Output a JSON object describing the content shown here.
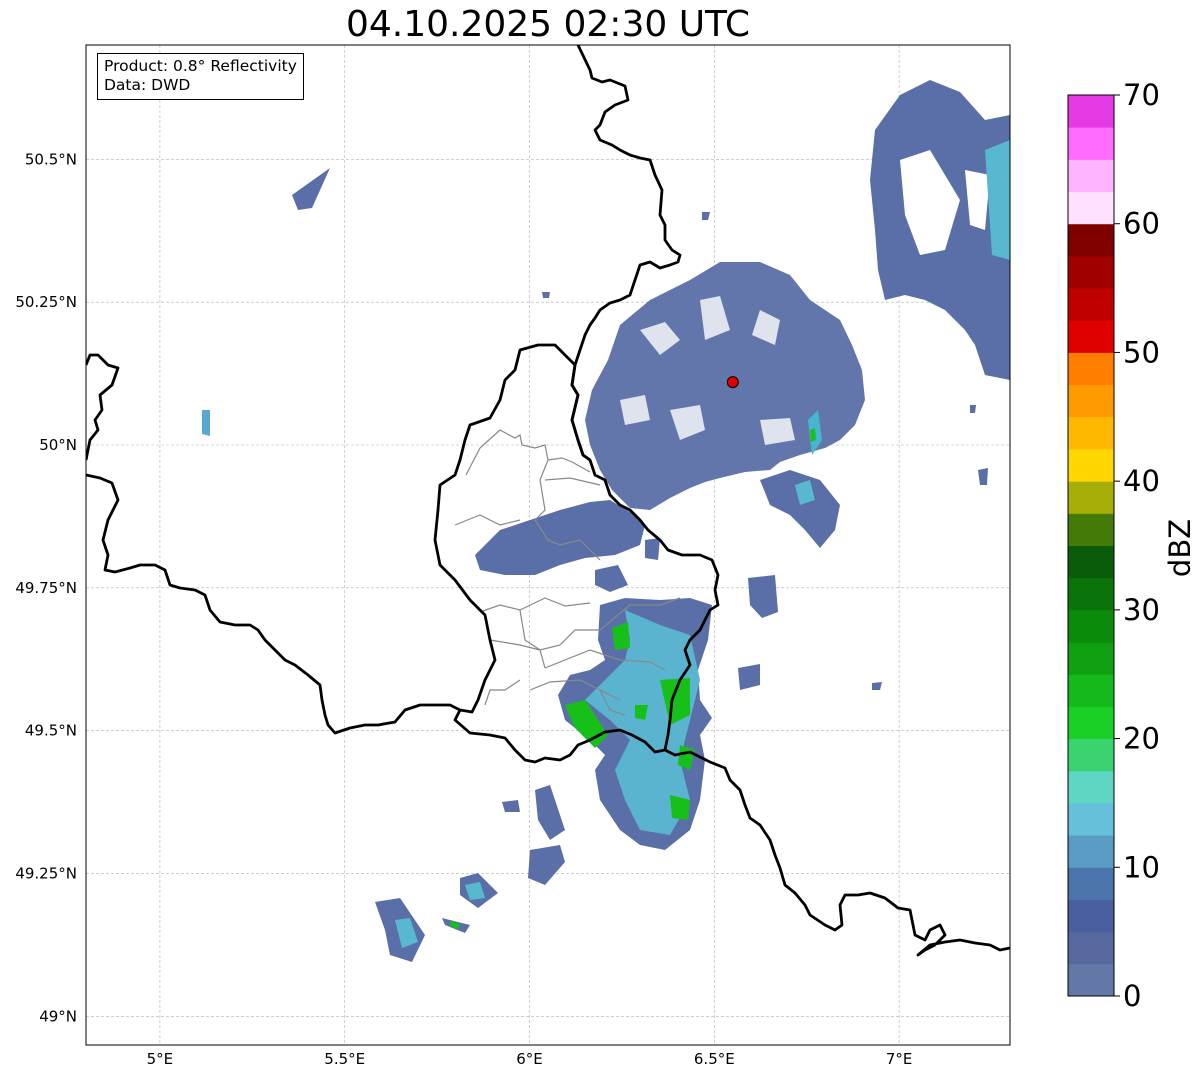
{
  "title": "04.10.2025 02:30 UTC",
  "info": {
    "product": "Product: 0.8° Reflectivity",
    "data": "Data: DWD"
  },
  "map_axes": {
    "lon_range": [
      4.8,
      7.3
    ],
    "lat_range": [
      48.95,
      50.7
    ],
    "lon_ticks": [
      5.0,
      5.5,
      6.0,
      6.5,
      7.0
    ],
    "lon_tick_labels": [
      "5°E",
      "5.5°E",
      "6°E",
      "6.5°E",
      "7°E"
    ],
    "lat_ticks": [
      49.0,
      49.25,
      49.5,
      49.75,
      50.0,
      50.25,
      50.5
    ],
    "lat_tick_labels": [
      "49°N",
      "49.25°N",
      "49.5°N",
      "49.75°N",
      "50°N",
      "50.25°N",
      "50.5°N"
    ],
    "grid": true
  },
  "radar_site": {
    "lon": 6.55,
    "lat": 50.11,
    "color": "#e00000"
  },
  "colorbar": {
    "label": "dBZ",
    "min": 0,
    "max": 70,
    "step": 2.5,
    "tick_values": [
      0,
      10,
      20,
      30,
      40,
      50,
      60,
      70
    ],
    "tick_labels": [
      "0",
      "10",
      "20",
      "30",
      "40",
      "50",
      "60",
      "70"
    ],
    "colors": [
      "#6478a8",
      "#57689f",
      "#485e9e",
      "#4b74ac",
      "#5a9bc4",
      "#66c0d9",
      "#5fd6c4",
      "#3ad370",
      "#1acf25",
      "#15b91c",
      "#109f10",
      "#0c8a0c",
      "#0a740a",
      "#0a5c0a",
      "#447a08",
      "#a8ae08",
      "#ffd600",
      "#ffb800",
      "#ff9a00",
      "#ff7e00",
      "#e00000",
      "#c00000",
      "#a00000",
      "#800000",
      "#ffe0ff",
      "#ffb4ff",
      "#ff6cff",
      "#e63ae6"
    ]
  },
  "legend_colors": {
    "low": "#5a6fa8",
    "mid": "#5ab4d0",
    "green": "#16c018",
    "border": "#000000",
    "admin": "#888888"
  }
}
